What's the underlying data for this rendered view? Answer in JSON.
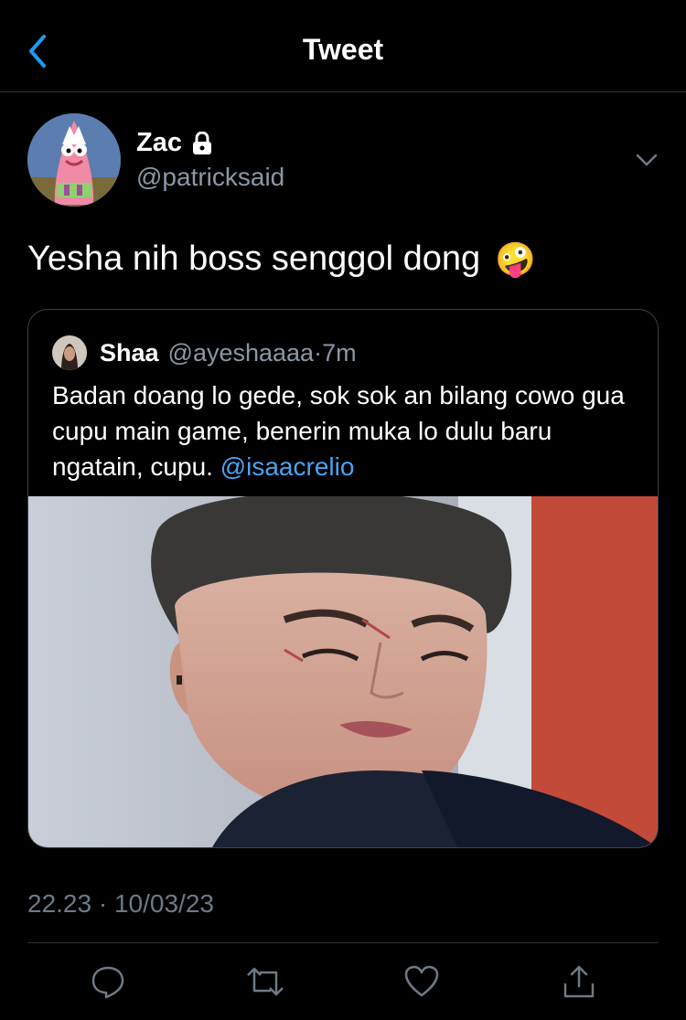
{
  "nav": {
    "title": "Tweet",
    "accent": "#1d9bf0"
  },
  "author": {
    "name": "Zac",
    "handle": "@patricksaid",
    "locked": true
  },
  "tweet": {
    "text": "Yesha nih boss senggol dong",
    "emoji": "🤪"
  },
  "quote": {
    "name": "Shaa",
    "handle": "@ayeshaaaa",
    "separator": " · ",
    "time": "7m",
    "text": "Badan doang lo gede, sok sok an bilang cowo gua cupu main game, benerin muka lo dulu baru ngatain, cupu. ",
    "mention": "@isaacrelio"
  },
  "meta": {
    "time": "22.23",
    "separator": " · ",
    "date": "10/03/23"
  },
  "actions": [
    {
      "icon": "reply-icon"
    },
    {
      "icon": "retweet-icon"
    },
    {
      "icon": "like-icon"
    },
    {
      "icon": "share-icon"
    }
  ],
  "colors": {
    "background": "#000000",
    "muted": "#8b98a5",
    "link": "#4aa3f0",
    "border": "#38444d"
  }
}
